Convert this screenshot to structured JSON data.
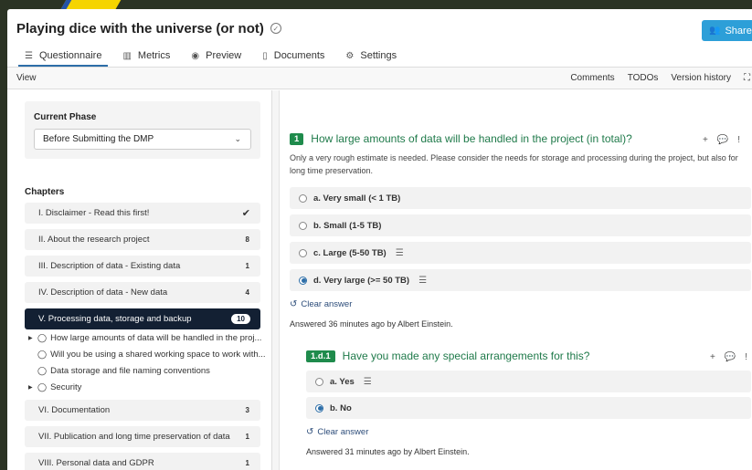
{
  "header": {
    "title": "Playing dice with the universe (or not)",
    "share_label": "Share"
  },
  "tabs": [
    {
      "label": "Questionnaire",
      "icon": "list-icon"
    },
    {
      "label": "Metrics",
      "icon": "bar-chart-icon"
    },
    {
      "label": "Preview",
      "icon": "eye-icon"
    },
    {
      "label": "Documents",
      "icon": "document-icon"
    },
    {
      "label": "Settings",
      "icon": "gears-icon"
    }
  ],
  "subbar": {
    "view": "View",
    "comments": "Comments",
    "todos": "TODOs",
    "version_history": "Version history"
  },
  "phase": {
    "label": "Current Phase",
    "selected": "Before Submitting the DMP"
  },
  "chapters_heading": "Chapters",
  "chapters": [
    {
      "label": "I. Disclaimer - Read this first!",
      "badge": "✔"
    },
    {
      "label": "II. About the research project",
      "badge": "8"
    },
    {
      "label": "III. Description of data - Existing data",
      "badge": "1"
    },
    {
      "label": "IV. Description of data - New data",
      "badge": "4"
    },
    {
      "label": "V. Processing data, storage and backup",
      "badge": "10"
    },
    {
      "label": "VI. Documentation",
      "badge": "3"
    },
    {
      "label": "VII. Publication and long time preservation of data",
      "badge": "1"
    },
    {
      "label": "VIII. Personal data and GDPR",
      "badge": "1"
    }
  ],
  "sub_questions": [
    "How large amounts of data will be handled in the proj...",
    "Will you be using a shared working space to work with...",
    "Data storage and file naming conventions",
    "Security"
  ],
  "question1": {
    "number": "1",
    "title": "How large amounts of data will be handled in the project (in total)?",
    "description": "Only a very rough estimate is needed. Please consider the needs for storage and processing during the project, but also for long time preservation.",
    "options": [
      {
        "label": "a. Very small (< 1 TB)",
        "selected": false
      },
      {
        "label": "b. Small (1-5 TB)",
        "selected": false
      },
      {
        "label": "c. Large (5-50 TB)",
        "selected": false
      },
      {
        "label": "d. Very large (>= 50 TB)",
        "selected": true
      }
    ],
    "clear_label": "Clear answer",
    "answered": "Answered 36 minutes ago by Albert Einstein."
  },
  "question2": {
    "number": "1.d.1",
    "title": "Have you made any special arrangements for this?",
    "options": [
      {
        "label": "a. Yes",
        "selected": false
      },
      {
        "label": "b. No",
        "selected": true
      }
    ],
    "clear_label": "Clear answer",
    "answered": "Answered 31 minutes ago by Albert Einstein."
  },
  "colors": {
    "accent_green": "#1f8b4c",
    "share_blue": "#2d9fd8",
    "active_chapter_bg": "#132033"
  }
}
